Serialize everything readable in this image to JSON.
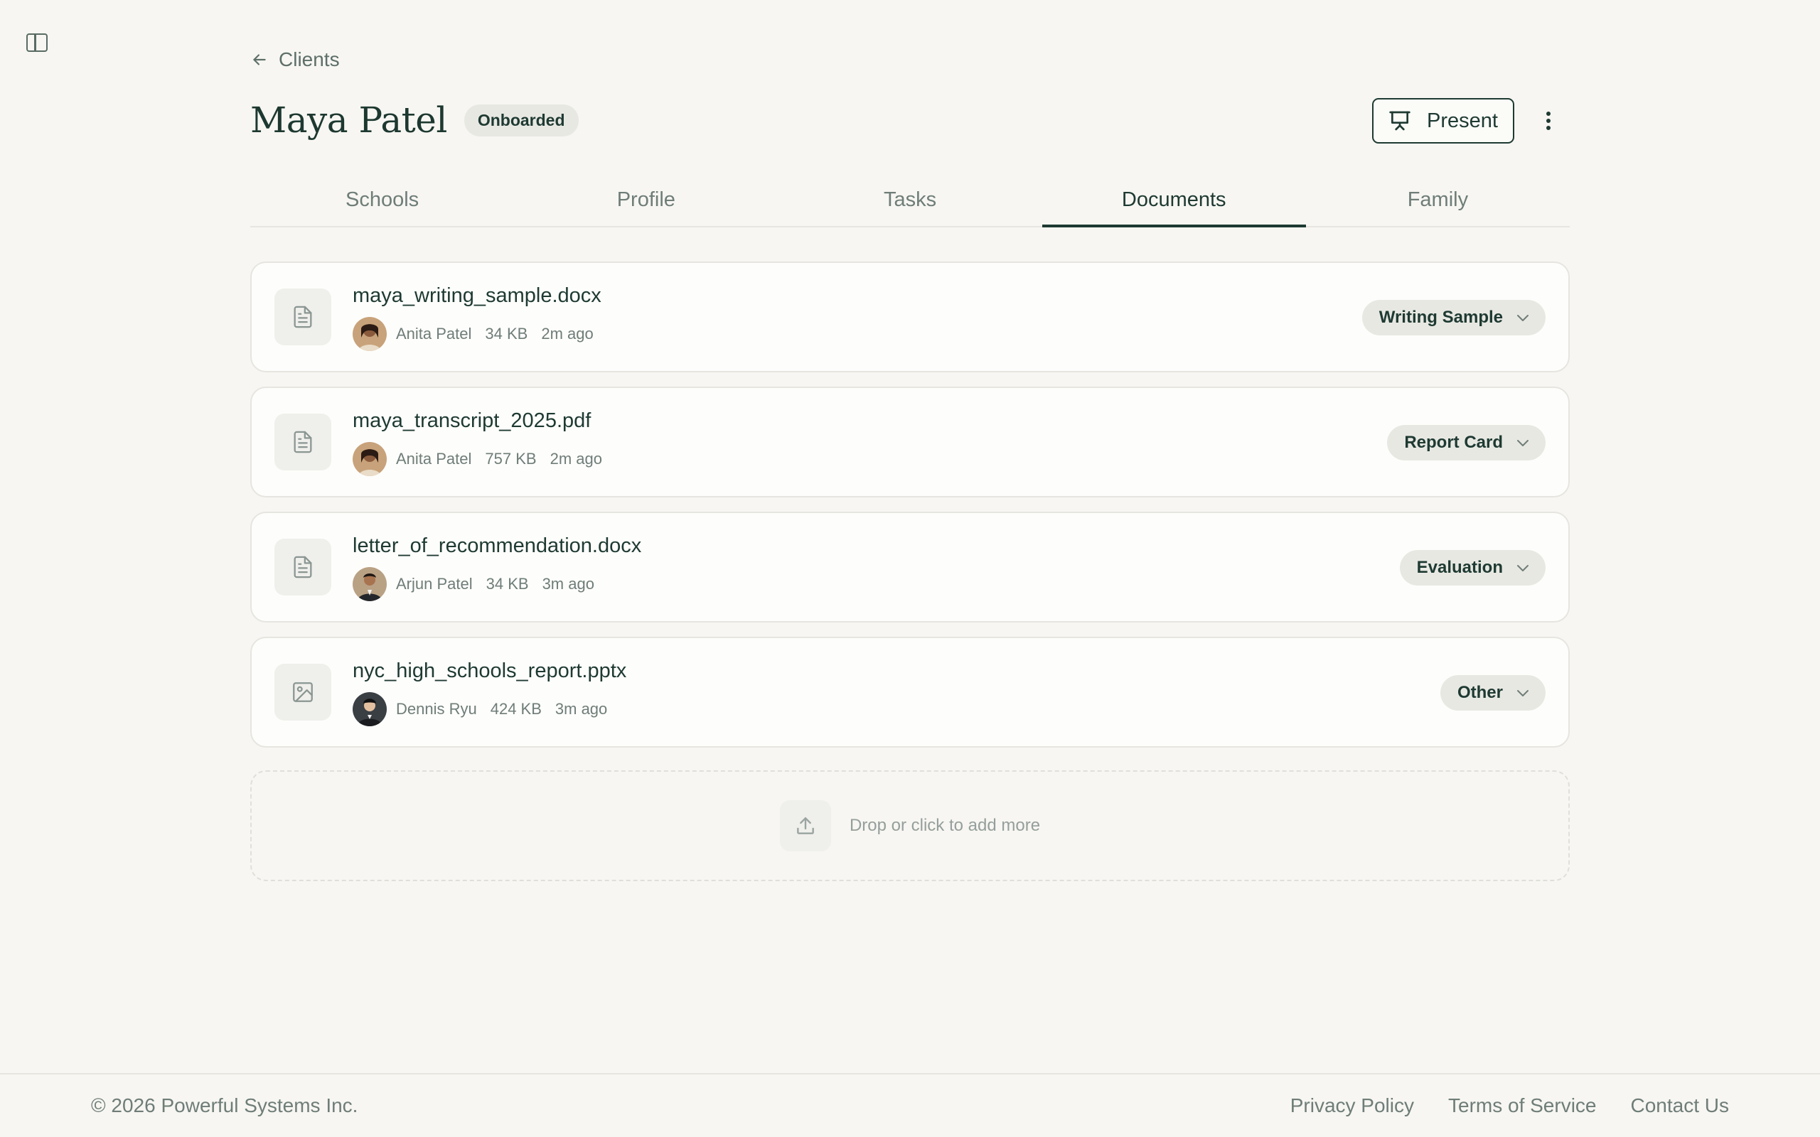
{
  "nav": {
    "back_label": "Clients"
  },
  "client": {
    "name": "Maya Patel",
    "status": "Onboarded"
  },
  "actions": {
    "present_label": "Present"
  },
  "tabs": [
    {
      "label": "Schools",
      "active": false
    },
    {
      "label": "Profile",
      "active": false
    },
    {
      "label": "Tasks",
      "active": false
    },
    {
      "label": "Documents",
      "active": true
    },
    {
      "label": "Family",
      "active": false
    }
  ],
  "documents": [
    {
      "name": "maya_writing_sample.docx",
      "uploader": "Anita Patel",
      "size": "34 KB",
      "time": "2m ago",
      "type": "Writing Sample",
      "icon": "document-icon"
    },
    {
      "name": "maya_transcript_2025.pdf",
      "uploader": "Anita Patel",
      "size": "757 KB",
      "time": "2m ago",
      "type": "Report Card",
      "icon": "document-icon"
    },
    {
      "name": "letter_of_recommendation.docx",
      "uploader": "Arjun Patel",
      "size": "34 KB",
      "time": "3m ago",
      "type": "Evaluation",
      "icon": "document-icon"
    },
    {
      "name": "nyc_high_schools_report.pptx",
      "uploader": "Dennis Ryu",
      "size": "424 KB",
      "time": "3m ago",
      "type": "Other",
      "icon": "image-icon"
    }
  ],
  "upload": {
    "label": "Drop or click to add more"
  },
  "footer": {
    "copyright": "© 2026 Powerful Systems Inc.",
    "links": [
      "Privacy Policy",
      "Terms of Service",
      "Contact Us"
    ]
  },
  "colors": {
    "accent": "#1e3a32",
    "background": "#f7f6f2",
    "muted": "#6f7d78"
  }
}
